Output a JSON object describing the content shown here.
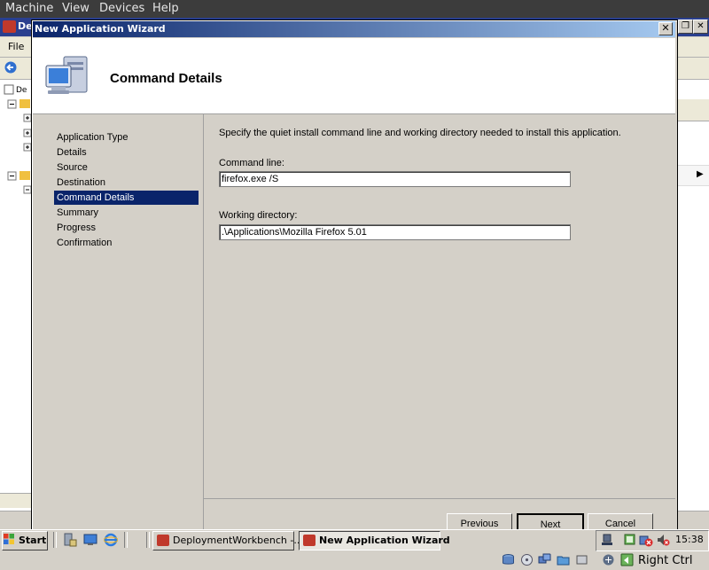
{
  "host_menu": {
    "machine": "Machine",
    "view": "View",
    "devices": "Devices",
    "help": "Help"
  },
  "background_app": {
    "title": "De",
    "file_menu": "File"
  },
  "wizard": {
    "title": "New Application Wizard",
    "close_label": "✕",
    "header_title": "Command Details",
    "nav_items": [
      "Application Type",
      "Details",
      "Source",
      "Destination",
      "Command Details",
      "Summary",
      "Progress",
      "Confirmation"
    ],
    "active_nav": "Command Details",
    "instructions": "Specify the quiet install command line and working directory needed to install this application.",
    "command_line_label": "Command line:",
    "command_line_value": "firefox.exe /S",
    "working_dir_label": "Working directory:",
    "working_dir_value": ".\\Applications\\Mozilla Firefox 5.01",
    "buttons": {
      "previous": "Previous",
      "next": "Next",
      "cancel": "Cancel"
    }
  },
  "taskbar": {
    "start": "Start",
    "tasks": [
      "DeploymentWorkbench -...",
      "New Application Wizard"
    ],
    "clock": "15:38"
  },
  "vbox_status": {
    "host_key": "Right Ctrl"
  }
}
